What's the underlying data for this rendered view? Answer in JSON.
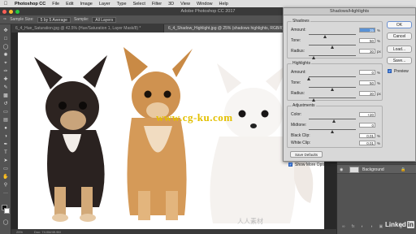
{
  "menubar": {
    "apple_icon": "apple-icon",
    "app_name": "Photoshop CC",
    "items": [
      "File",
      "Edit",
      "Image",
      "Layer",
      "Type",
      "Select",
      "Filter",
      "3D",
      "View",
      "Window",
      "Help"
    ]
  },
  "window": {
    "title": "Adobe Photoshop CC 2017"
  },
  "options": {
    "sample_size_label": "Sample Size:",
    "sample_size_value": "5 by 5 Average",
    "sample_label": "Sample:",
    "sample_value": "All Layers"
  },
  "tabs": [
    {
      "label": "6_4_Hue_Saturation.jpg @ 42.5% (Hue/Saturation 1, Layer Mask/8) *"
    },
    {
      "label": "6_4_Shadow_Highlight.jpg @ 25% (shadows highlights, RGB/8) *"
    }
  ],
  "canvas": {
    "watermark": "www.cg-ku.com",
    "watermark2": "人人素材"
  },
  "status": {
    "zoom": "25%",
    "doc": "Doc: 74.0M/49.9M"
  },
  "layers": {
    "name": "Background"
  },
  "branding": {
    "text": "Linked",
    "in": "in"
  },
  "dialog": {
    "title": "Shadows/Highlights",
    "shadows": {
      "title": "Shadows",
      "amount": {
        "label": "Amount:",
        "value": "35",
        "unit": "%",
        "level": 0.35
      },
      "tone": {
        "label": "Tone:",
        "value": "50",
        "unit": "%",
        "level": 0.5
      },
      "radius": {
        "label": "Radius:",
        "value": "30",
        "unit": "px",
        "level": 0.12
      }
    },
    "highlights": {
      "title": "Highlights",
      "amount": {
        "label": "Amount:",
        "value": "0",
        "unit": "%",
        "level": 0.0
      },
      "tone": {
        "label": "Tone:",
        "value": "50",
        "unit": "%",
        "level": 0.5
      },
      "radius": {
        "label": "Radius:",
        "value": "30",
        "unit": "px",
        "level": 0.12
      }
    },
    "adjustments": {
      "title": "Adjustments",
      "color": {
        "label": "Color:",
        "value": "+20",
        "level": 0.55
      },
      "midtone": {
        "label": "Midtone:",
        "value": "0",
        "level": 0.5
      },
      "black_clip": {
        "label": "Black Clip:",
        "value": "0.01",
        "unit": "%"
      },
      "white_clip": {
        "label": "White Clip:",
        "value": "0.01",
        "unit": "%"
      }
    },
    "save_defaults": "Save Defaults",
    "show_more": "Show More Options",
    "buttons": {
      "ok": "OK",
      "cancel": "Cancel",
      "load": "Load...",
      "save": "Save..."
    },
    "preview": "Preview"
  },
  "colors": {
    "accent": "#3b78d8",
    "watermark": "#e3c000"
  }
}
